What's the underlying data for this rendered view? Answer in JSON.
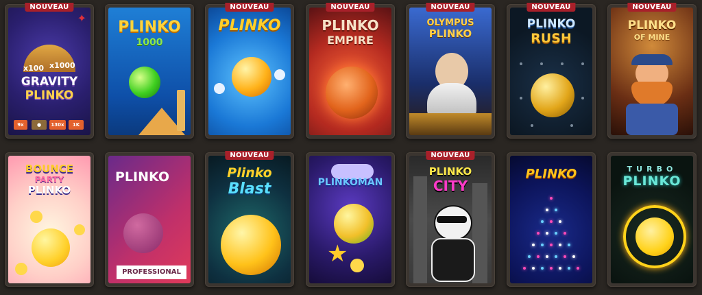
{
  "badge_label": "NOUVEAU",
  "games": [
    {
      "title": "GRAVITY PLINKO",
      "title_l1": "GRAVITY",
      "title_l2": "PLINKO",
      "mult_a": "x100",
      "mult_b": "x1000",
      "chips": [
        "9x",
        "130x",
        "1K"
      ],
      "is_new": true
    },
    {
      "title": "PLINKO 1000",
      "title_l1": "PLINKO",
      "title_l2": "1000",
      "is_new": false
    },
    {
      "title": "PLINKO",
      "title_l1": "PLINKO",
      "is_new": true
    },
    {
      "title": "PLINKO EMPIRE",
      "title_l1": "PLINKO",
      "title_l2": "EMPIRE",
      "is_new": true
    },
    {
      "title": "OLYMPUS PLINKO",
      "title_l1": "OLYMPUS",
      "title_l2": "PLINKO",
      "is_new": true
    },
    {
      "title": "PLINKO RUSH",
      "title_l1": "PLINKO",
      "title_l2": "RUSH",
      "is_new": true
    },
    {
      "title": "PLINKO OF MINE",
      "title_l1": "PLINKO",
      "title_l2": "OF MINE",
      "is_new": true
    },
    {
      "title": "BOUNCE PARTY PLINKO",
      "title_l1": "BOUNCE",
      "title_l2": "PARTY",
      "title_l3": "PLINKO",
      "is_new": false
    },
    {
      "title": "PLINKO PROFESSIONAL",
      "title_l1": "PLINKO",
      "title_l2": "PROFESSIONAL",
      "is_new": false
    },
    {
      "title": "PLINKO BLAST",
      "title_l1": "Plinko",
      "title_l2": "Blast",
      "is_new": true
    },
    {
      "title": "PLINKOMAN",
      "title_l1": "PLINKOMAN",
      "is_new": false
    },
    {
      "title": "PLINKO CITY",
      "title_l1": "PLINKO",
      "title_l2": "CITY",
      "is_new": true
    },
    {
      "title": "PLINKO",
      "title_l1": "PLINKO",
      "is_new": false
    },
    {
      "title": "TURBO PLINKO",
      "title_l1": "TURBO",
      "title_l2": "PLINKO",
      "is_new": false
    }
  ],
  "colors": {
    "background": "#2a2622",
    "badge": "#a8202a",
    "frame": "#3b3530"
  }
}
